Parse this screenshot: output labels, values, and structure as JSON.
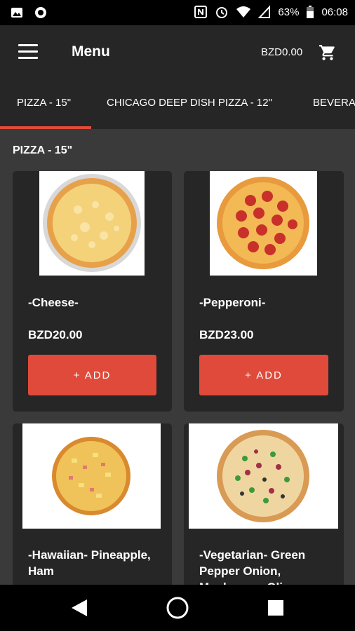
{
  "status_bar": {
    "battery": "63%",
    "time": "06:08"
  },
  "app_bar": {
    "title": "Menu",
    "cart_total": "BZD0.00"
  },
  "tabs": [
    {
      "label": "PIZZA - 15\""
    },
    {
      "label": "CHICAGO DEEP DISH PIZZA - 12\""
    },
    {
      "label": "BEVERA"
    }
  ],
  "section": {
    "title": "PIZZA - 15\""
  },
  "products": [
    {
      "name": "-Cheese-",
      "price": "BZD20.00",
      "add_label": "+ ADD",
      "icon": "cheese-pizza"
    },
    {
      "name": "-Pepperoni-",
      "price": "BZD23.00",
      "add_label": "+ ADD",
      "icon": "pepperoni-pizza"
    },
    {
      "name": "-Hawaiian- Pineapple, Ham",
      "icon": "hawaiian-pizza"
    },
    {
      "name": "-Vegetarian- Green Pepper Onion, Mushroom, Olives",
      "icon": "vegetarian-pizza"
    }
  ],
  "colors": {
    "accent": "#e04a3a",
    "background": "#3a3a3a",
    "surface": "#262626"
  }
}
